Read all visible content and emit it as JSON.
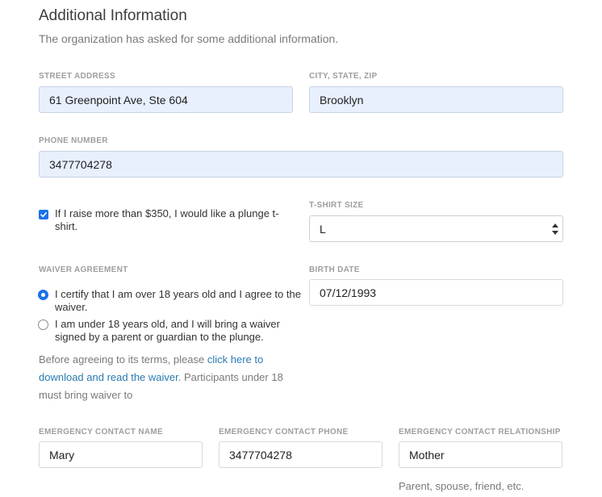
{
  "header": {
    "title": "Additional Information",
    "subtitle": "The organization has asked for some additional information."
  },
  "fields": {
    "street_address": {
      "label": "STREET ADDRESS",
      "value": "61 Greenpoint Ave, Ste 604"
    },
    "city_state_zip": {
      "label": "CITY, STATE, ZIP",
      "value": "Brooklyn"
    },
    "phone_number": {
      "label": "PHONE NUMBER",
      "value": "3477704278"
    },
    "tshirt_opt_in": {
      "label": "If I raise more than $350, I would like a plunge t-shirt.",
      "checked": true
    },
    "tshirt_size": {
      "label": "T-SHIRT SIZE",
      "value": "L"
    },
    "birth_date": {
      "label": "BIRTH DATE",
      "value": "07/12/1993"
    },
    "emergency_name": {
      "label": "EMERGENCY CONTACT NAME",
      "value": "Mary"
    },
    "emergency_phone": {
      "label": "EMERGENCY CONTACT PHONE",
      "value": "3477704278"
    },
    "emergency_relationship": {
      "label": "EMERGENCY CONTACT RELATIONSHIP",
      "value": "Mother",
      "hint": "Parent, spouse, friend, etc."
    }
  },
  "waiver": {
    "label": "WAIVER AGREEMENT",
    "options": [
      {
        "text": "I certify that I am over 18 years old and I agree to the waiver.",
        "selected": true
      },
      {
        "text": "I am under 18 years old, and I will bring a waiver signed by a parent or guardian to the plunge.",
        "selected": false
      }
    ],
    "note_before": "Before agreeing to its terms, please ",
    "note_link": "click here to download and read the waiver",
    "note_after": ". Participants under 18 must bring waiver to"
  },
  "colors": {
    "accent": "#1a73e8",
    "autofill_bg": "#e8f0fe",
    "link": "#2a7ab0"
  }
}
